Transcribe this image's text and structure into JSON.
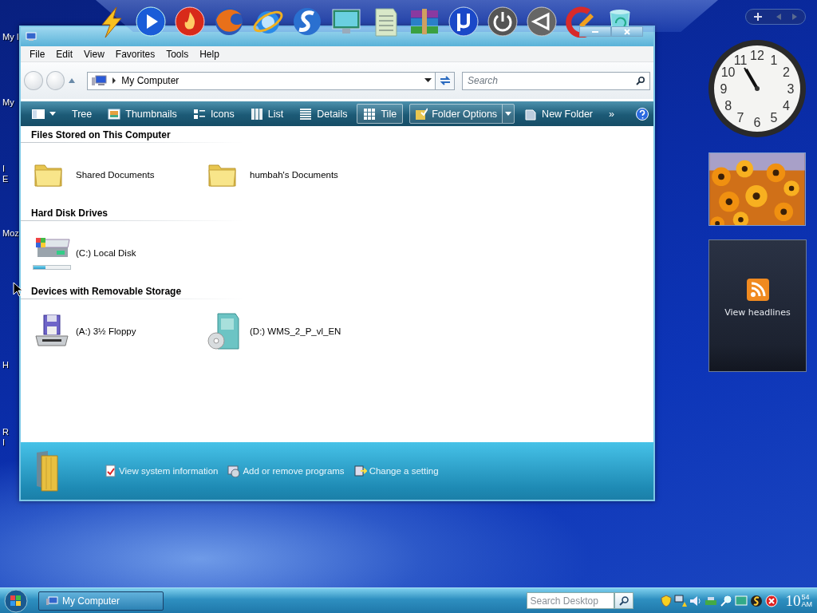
{
  "desktop_icons": [
    {
      "lines": [
        "My I"
      ]
    },
    {
      "lines": [
        "My"
      ]
    },
    {
      "lines": [
        "I",
        "E"
      ]
    },
    {
      "lines": [
        "Moz"
      ]
    },
    {
      "lines": [
        "H"
      ]
    },
    {
      "lines": [
        "R",
        "I"
      ]
    }
  ],
  "window": {
    "menu": [
      "File",
      "Edit",
      "View",
      "Favorites",
      "Tools",
      "Help"
    ],
    "address": "My Computer",
    "search_placeholder": "Search",
    "views": [
      {
        "label": "Tree",
        "kind": "tree",
        "selected": false
      },
      {
        "label": "Thumbnails",
        "kind": "thumbnails",
        "selected": false
      },
      {
        "label": "Icons",
        "kind": "icons",
        "selected": false
      },
      {
        "label": "List",
        "kind": "list",
        "selected": false
      },
      {
        "label": "Details",
        "kind": "details",
        "selected": false
      },
      {
        "label": "Tile",
        "kind": "tile",
        "selected": true
      }
    ],
    "folder_options": "Folder Options",
    "new_folder": "New Folder",
    "more": "»",
    "sections": [
      {
        "title": "Files Stored on This Computer",
        "items": [
          {
            "name": "Shared Documents",
            "kind": "folder"
          },
          {
            "name": "humbah's Documents",
            "kind": "folder"
          }
        ]
      },
      {
        "title": "Hard Disk Drives",
        "items": [
          {
            "name": "(C:) Local Disk",
            "kind": "disk",
            "level": 0.33
          }
        ]
      },
      {
        "title": "Devices with Removable Storage",
        "items": [
          {
            "name": "(A:) 3½ Floppy",
            "kind": "floppy"
          },
          {
            "name": "(D:) WMS_2_P_vl_EN",
            "kind": "cd"
          }
        ]
      }
    ],
    "tasks": [
      {
        "label": "View system information",
        "kind": "info"
      },
      {
        "label": "Add or remove programs",
        "kind": "programs"
      },
      {
        "label": "Change a setting",
        "kind": "setting"
      }
    ]
  },
  "gadgets": {
    "clock": {
      "numerals": [
        "12",
        "11",
        "1",
        "10",
        "2",
        "9",
        "3",
        "8",
        "4",
        "7",
        "5",
        "6"
      ]
    },
    "feed": {
      "label": "View headlines"
    }
  },
  "taskbar": {
    "tasks": [
      {
        "label": "My Computer"
      }
    ],
    "search_placeholder": "Search Desktop",
    "time": {
      "hour": "10",
      "minute": "54",
      "period": "AM"
    }
  }
}
